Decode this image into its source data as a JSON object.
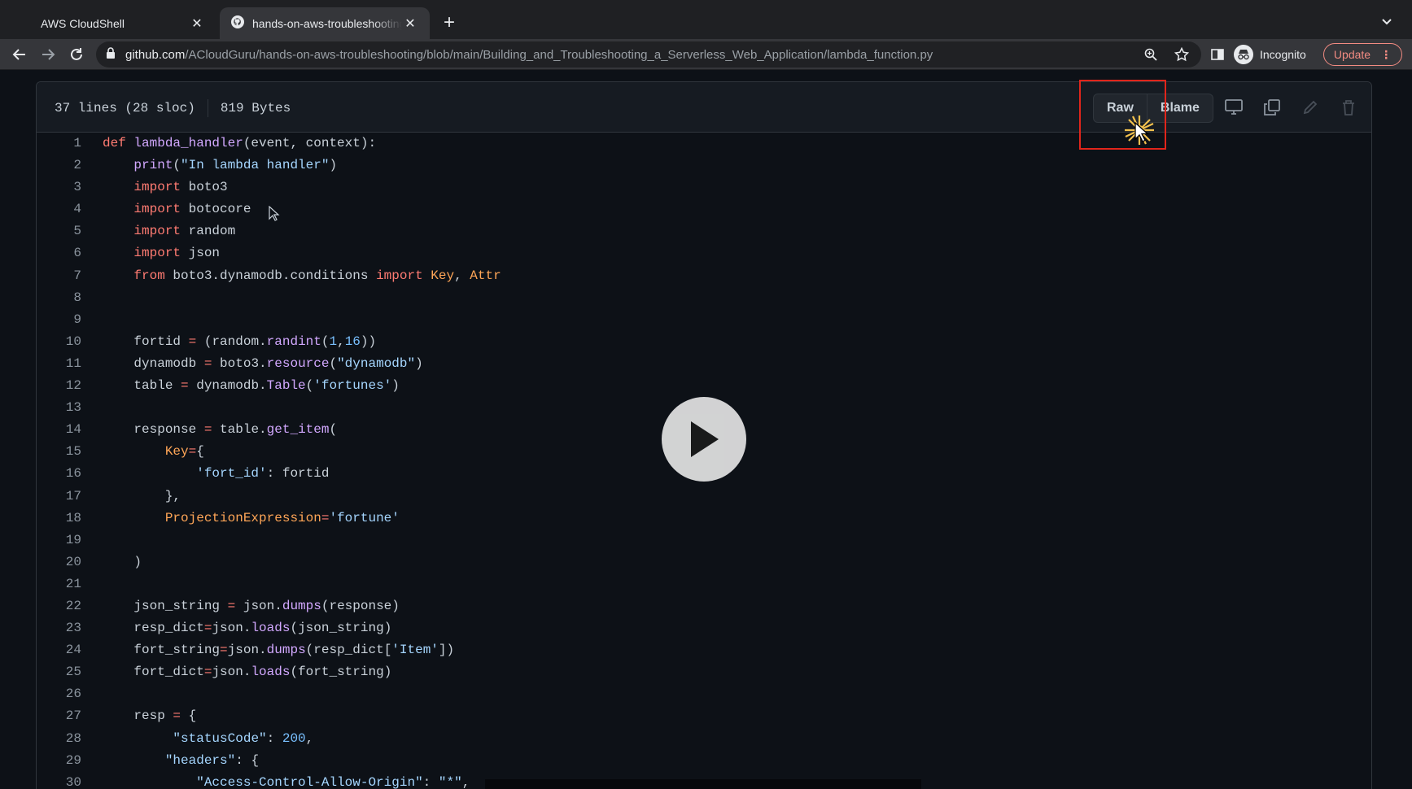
{
  "browser": {
    "tabs": [
      {
        "title": "AWS CloudShell",
        "active": false
      },
      {
        "title": "hands-on-aws-troubleshooting",
        "active": true
      }
    ],
    "address": {
      "host": "github.com",
      "path": "/ACloudGuru/hands-on-aws-troubleshooting/blob/main/Building_and_Troubleshooting_a_Serverless_Web_Application/lambda_function.py"
    },
    "profile_label": "Incognito",
    "update_label": "Update"
  },
  "file": {
    "lines_info": "37 lines (28 sloc)",
    "size_info": "819 Bytes",
    "buttons": {
      "raw": "Raw",
      "blame": "Blame"
    },
    "code": [
      [
        [
          "k",
          "def "
        ],
        [
          "f",
          "lambda_handler"
        ],
        [
          "",
          "(event, context):"
        ]
      ],
      [
        [
          "",
          "    "
        ],
        [
          "f",
          "print"
        ],
        [
          "",
          "("
        ],
        [
          "s",
          "\"In lambda handler\""
        ],
        [
          "",
          ")"
        ]
      ],
      [
        [
          "",
          "    "
        ],
        [
          "k",
          "import"
        ],
        [
          "",
          " boto3"
        ]
      ],
      [
        [
          "",
          "    "
        ],
        [
          "k",
          "import"
        ],
        [
          "",
          " botocore"
        ]
      ],
      [
        [
          "",
          "    "
        ],
        [
          "k",
          "import"
        ],
        [
          "",
          " random"
        ]
      ],
      [
        [
          "",
          "    "
        ],
        [
          "k",
          "import"
        ],
        [
          "",
          " json"
        ]
      ],
      [
        [
          "",
          "    "
        ],
        [
          "k",
          "from"
        ],
        [
          "",
          " boto3.dynamodb.conditions "
        ],
        [
          "k",
          "import"
        ],
        [
          "",
          " "
        ],
        [
          "p",
          "Key"
        ],
        [
          "",
          ", "
        ],
        [
          "p",
          "Attr"
        ]
      ],
      [],
      [],
      [
        [
          "",
          "    fortid "
        ],
        [
          "k",
          "="
        ],
        [
          "",
          " (random."
        ],
        [
          "f",
          "randint"
        ],
        [
          "",
          "("
        ],
        [
          "n",
          "1"
        ],
        [
          "",
          ","
        ],
        [
          "n",
          "16"
        ],
        [
          "",
          "))"
        ]
      ],
      [
        [
          "",
          "    dynamodb "
        ],
        [
          "k",
          "="
        ],
        [
          "",
          " boto3."
        ],
        [
          "f",
          "resource"
        ],
        [
          "",
          "("
        ],
        [
          "s",
          "\"dynamodb\""
        ],
        [
          "",
          ")"
        ]
      ],
      [
        [
          "",
          "    table "
        ],
        [
          "k",
          "="
        ],
        [
          "",
          " dynamodb."
        ],
        [
          "f",
          "Table"
        ],
        [
          "",
          "("
        ],
        [
          "s",
          "'fortunes'"
        ],
        [
          "",
          ")"
        ]
      ],
      [],
      [
        [
          "",
          "    response "
        ],
        [
          "k",
          "="
        ],
        [
          "",
          " table."
        ],
        [
          "f",
          "get_item"
        ],
        [
          "",
          "("
        ]
      ],
      [
        [
          "",
          "        "
        ],
        [
          "p",
          "Key"
        ],
        [
          "k",
          "="
        ],
        [
          "",
          "{"
        ]
      ],
      [
        [
          "",
          "            "
        ],
        [
          "s",
          "'fort_id'"
        ],
        [
          "",
          ": fortid"
        ]
      ],
      [
        [
          "",
          "        },"
        ]
      ],
      [
        [
          "",
          "        "
        ],
        [
          "p",
          "ProjectionExpression"
        ],
        [
          "k",
          "="
        ],
        [
          "s",
          "'fortune'"
        ]
      ],
      [],
      [
        [
          "",
          "    )"
        ]
      ],
      [],
      [
        [
          "",
          "    json_string "
        ],
        [
          "k",
          "="
        ],
        [
          "",
          " json."
        ],
        [
          "f",
          "dumps"
        ],
        [
          "",
          "(response)"
        ]
      ],
      [
        [
          "",
          "    resp_dict"
        ],
        [
          "k",
          "="
        ],
        [
          "",
          "json."
        ],
        [
          "f",
          "loads"
        ],
        [
          "",
          "(json_string)"
        ]
      ],
      [
        [
          "",
          "    fort_string"
        ],
        [
          "k",
          "="
        ],
        [
          "",
          "json."
        ],
        [
          "f",
          "dumps"
        ],
        [
          "",
          "(resp_dict["
        ],
        [
          "s",
          "'Item'"
        ],
        [
          "",
          "])"
        ]
      ],
      [
        [
          "",
          "    fort_dict"
        ],
        [
          "k",
          "="
        ],
        [
          "",
          "json."
        ],
        [
          "f",
          "loads"
        ],
        [
          "",
          "(fort_string)"
        ]
      ],
      [],
      [
        [
          "",
          "    resp "
        ],
        [
          "k",
          "="
        ],
        [
          "",
          " {"
        ]
      ],
      [
        [
          "",
          "         "
        ],
        [
          "s",
          "\"statusCode\""
        ],
        [
          "",
          ": "
        ],
        [
          "n",
          "200"
        ],
        [
          "",
          ","
        ]
      ],
      [
        [
          "",
          "        "
        ],
        [
          "s",
          "\"headers\""
        ],
        [
          "",
          ": {"
        ]
      ],
      [
        [
          "",
          "            "
        ],
        [
          "s",
          "\"Access-Control-Allow-Origin\""
        ],
        [
          "",
          ": "
        ],
        [
          "s",
          "\"*\""
        ],
        [
          "",
          ","
        ]
      ]
    ]
  },
  "colors": {
    "keyword": "#ff7b72",
    "function": "#d2a8ff",
    "string": "#a5d6ff",
    "number": "#79c0ff",
    "param": "#ffa657",
    "highlight_box": "#e1251b"
  },
  "icons": [
    "github-favicon",
    "close-icon",
    "plus-icon",
    "chevron-down-icon",
    "back-arrow-icon",
    "forward-arrow-icon",
    "reload-icon",
    "lock-icon",
    "zoom-icon",
    "star-icon",
    "side-panel-icon",
    "incognito-icon",
    "kebab-icon",
    "desktop-icon",
    "copy-icon",
    "pencil-icon",
    "trash-icon",
    "play-icon",
    "cursor-icon"
  ]
}
